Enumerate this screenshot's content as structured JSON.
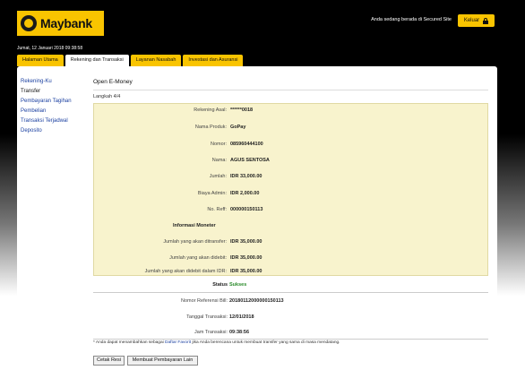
{
  "header": {
    "brand": "Maybank",
    "secured_text": "Anda sedang berada di Secured Site",
    "logout_label": "Keluar",
    "date": "Jumat, 12 Januari 2018 09:38:58"
  },
  "tabs": [
    {
      "label": "Halaman Utama"
    },
    {
      "label": "Rekening dan Transaksi"
    },
    {
      "label": "Layanan Nasabah"
    },
    {
      "label": "Investasi dan Asuransi"
    }
  ],
  "sidebar": {
    "items": [
      {
        "label": "Rekening-Ku"
      },
      {
        "label": "Transfer"
      },
      {
        "label": "Pembayaran Tagihan"
      },
      {
        "label": "Pembelian"
      },
      {
        "label": "Transaksi Terjadwal"
      },
      {
        "label": "Deposito"
      }
    ]
  },
  "main": {
    "title": "Open E-Money",
    "step": "Langkah 4/4",
    "details": [
      {
        "label": "Rekening Asal:",
        "value": "******0018"
      },
      {
        "label": "Nama Produk:",
        "value": "GoPay"
      },
      {
        "label": "Nomor:",
        "value": "085960444100"
      },
      {
        "label": "Nama:",
        "value": "AGUS SENTOSA"
      },
      {
        "label": "Jumlah:",
        "value": "IDR 33,000.00"
      },
      {
        "label": "Biaya Admin:",
        "value": "IDR 2,000.00"
      },
      {
        "label": "No. Reff:",
        "value": "000000150113"
      }
    ],
    "info_header": "Informasi Moneter",
    "monetary": [
      {
        "label": "Jumlah yang akan ditransfer:",
        "value": "IDR 35,000.00"
      },
      {
        "label": "Jumlah yang akan didebit:",
        "value": "IDR 35,000.00"
      },
      {
        "label": "Jumlah yang akan didebit dalam IDR:",
        "value": "IDR 35,000.00"
      }
    ],
    "status_label": "Status",
    "status_value": "Sukses",
    "result": [
      {
        "label": "Nomor Referensi Bill:",
        "value": "20180112000000150113"
      },
      {
        "label": "Tanggal Transaksi:",
        "value": "12/01/2018"
      },
      {
        "label": "Jam Transaksi:",
        "value": "09:38:56"
      }
    ],
    "note_prefix": "* Anda dapat menambahkan sebagai",
    "note_link": "Daftar Favorit",
    "note_suffix": "jika Anda berencana untuk membuat transfer yang sama di masa mendatang.",
    "buttons": {
      "print": "Cetak Resi",
      "new_payment": "Membuat Pembayaran Lain"
    }
  },
  "colors": {
    "brand_yellow": "#f9c400",
    "panel_yellow": "#f8f3cd",
    "link_blue": "#1a3fa0",
    "success_green": "#2a8a2a"
  }
}
